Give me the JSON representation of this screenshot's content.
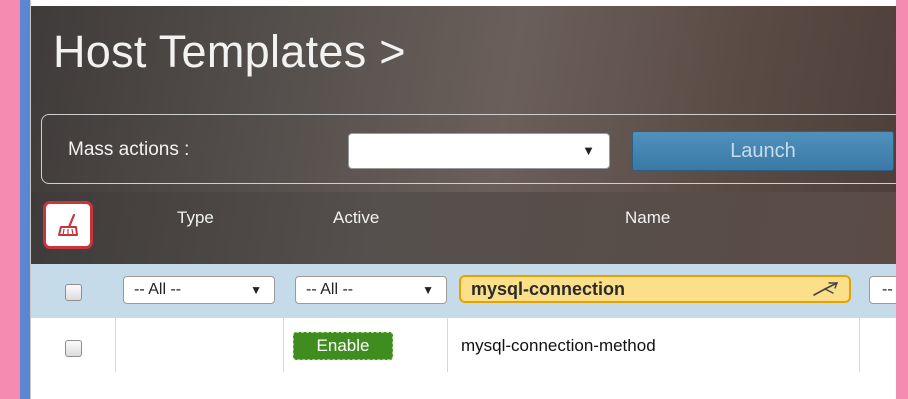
{
  "header": {
    "title": "Host Templates >"
  },
  "mass_actions": {
    "label": "Mass actions :",
    "select_value": "",
    "select_arrow": "▼",
    "launch_label": "Launch"
  },
  "table": {
    "columns": [
      "Type",
      "Active",
      "Name"
    ],
    "filters": {
      "type_value": "-- All --",
      "active_value": "-- All --",
      "name_value": "mysql-connection",
      "next_value": "--",
      "arrow": "▼"
    },
    "rows": [
      {
        "type": "",
        "active": "Enable",
        "name": "mysql-connection-method"
      }
    ]
  },
  "colors": {
    "accent_launch": "#3a79a6",
    "enable_badge": "#3f8d1f",
    "filter_highlight": "#fbe089",
    "reset_border": "#c8353a"
  },
  "icons": {
    "reset_filters": "broom-icon",
    "clear_input": "clear-input-icon"
  }
}
